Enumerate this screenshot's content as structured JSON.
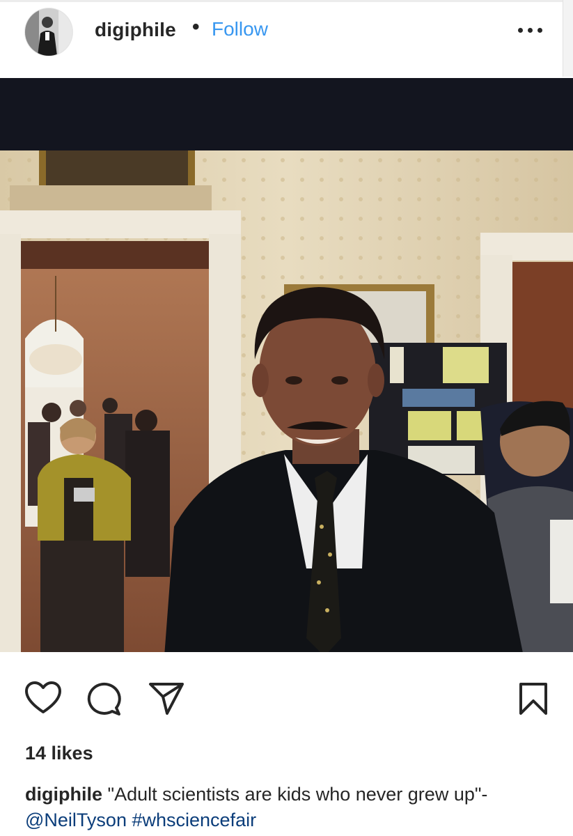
{
  "header": {
    "username": "digiphile",
    "separator": "•",
    "follow_label": "Follow"
  },
  "post": {
    "likes_text": "14 likes",
    "caption": {
      "username": "digiphile",
      "text": "\"Adult scientists are kids who never grew up\"-",
      "mention": "@NeilTyson",
      "hashtag": "#whsciencefair"
    }
  },
  "icons": {
    "like": "heart-outline-icon",
    "comment": "comment-bubble-icon",
    "share": "paper-plane-icon",
    "save": "bookmark-outline-icon",
    "more": "ellipsis-icon"
  },
  "colors": {
    "link_blue": "#3897f0",
    "text": "#262626",
    "image_border": "#13151f"
  }
}
